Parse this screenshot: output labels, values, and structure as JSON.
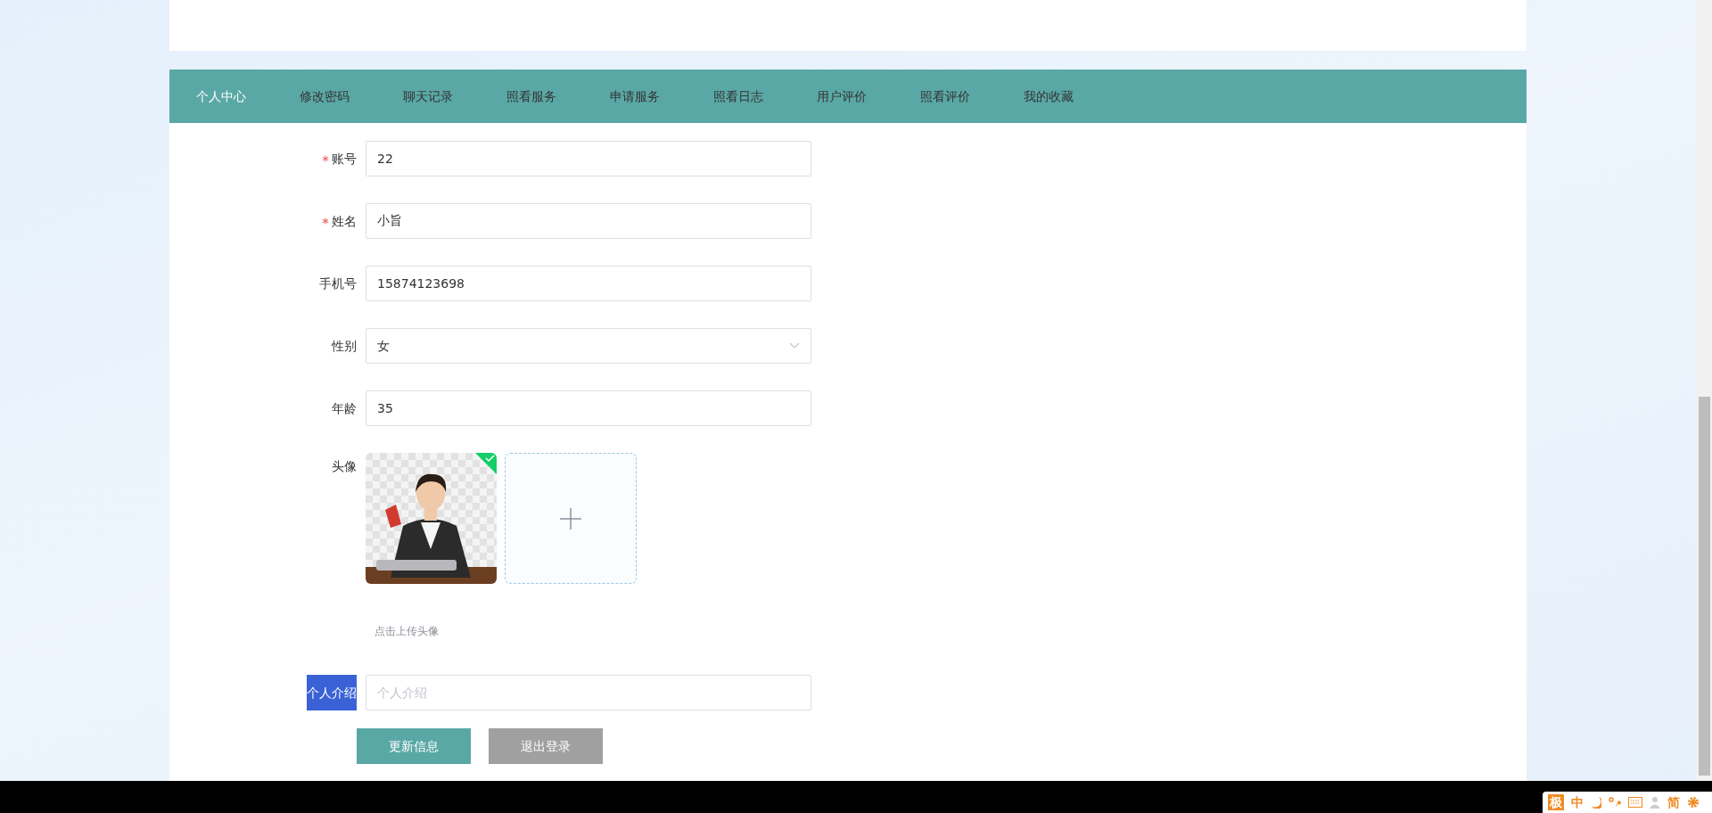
{
  "nav": {
    "items": [
      {
        "label": "个人中心",
        "selected": true
      },
      {
        "label": "修改密码",
        "selected": false
      },
      {
        "label": "聊天记录",
        "selected": false
      },
      {
        "label": "照看服务",
        "selected": false
      },
      {
        "label": "申请服务",
        "selected": false
      },
      {
        "label": "照看日志",
        "selected": false
      },
      {
        "label": "用户评价",
        "selected": false
      },
      {
        "label": "照看评价",
        "selected": false
      },
      {
        "label": "我的收藏",
        "selected": false
      }
    ]
  },
  "form": {
    "fields": [
      {
        "kind": "text",
        "label": "账号",
        "required": true,
        "value": "22"
      },
      {
        "kind": "text",
        "label": "姓名",
        "required": true,
        "value": "小旨"
      },
      {
        "kind": "text",
        "label": "手机号",
        "required": false,
        "value": "15874123698"
      },
      {
        "kind": "select",
        "label": "性别",
        "required": false,
        "value": "女"
      },
      {
        "kind": "text",
        "label": "年龄",
        "required": false,
        "value": "35"
      }
    ],
    "avatar": {
      "label": "头像",
      "uploaded": true,
      "hint": "点击上传头像"
    },
    "intro": {
      "label": "个人介绍",
      "label_highlighted": true,
      "placeholder": "个人介绍"
    },
    "buttons": [
      {
        "kind": "primary",
        "label": "更新信息"
      },
      {
        "kind": "secondary",
        "label": "退出登录"
      }
    ]
  },
  "ime_toolbar": {
    "logo": "极",
    "mode": "中",
    "charset": "简"
  }
}
